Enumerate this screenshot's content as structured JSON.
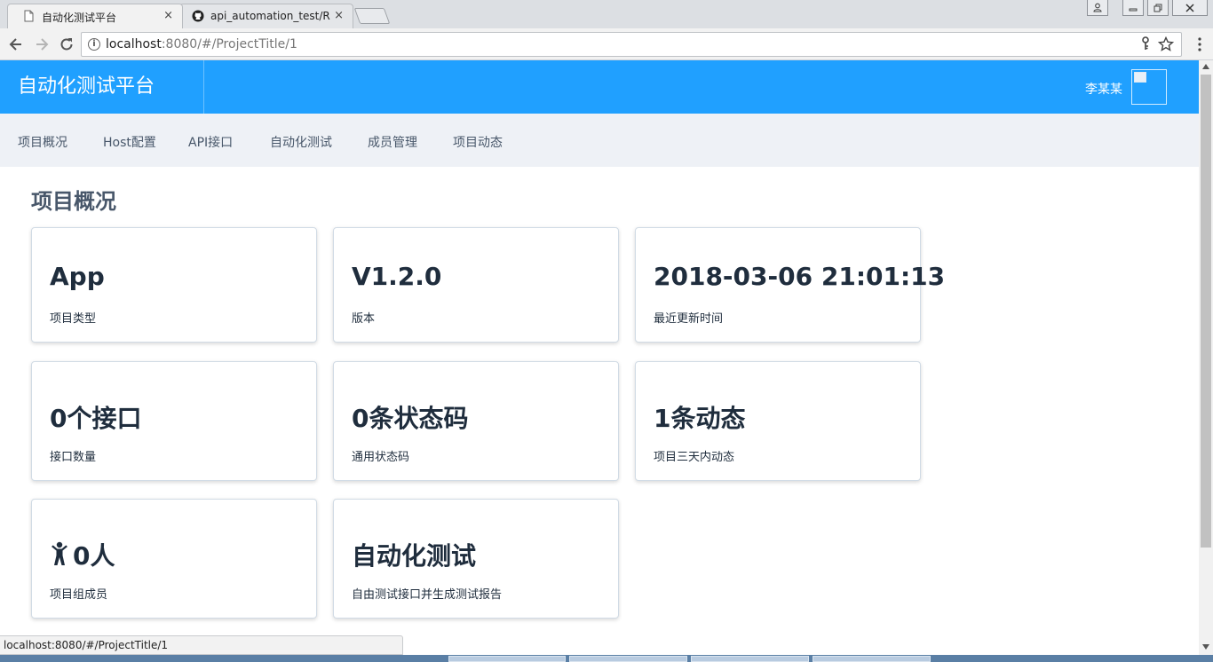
{
  "browser": {
    "tabs": [
      {
        "title": "自动化测试平台",
        "close": "×"
      },
      {
        "title": "api_automation_test/R",
        "close": "×"
      }
    ],
    "url_host": "localhost",
    "url_rest": ":8080/#/ProjectTitle/1",
    "status_text": "localhost:8080/#/ProjectTitle/1"
  },
  "header": {
    "brand": "自动化测试平台",
    "user_name": "李某某"
  },
  "nav": [
    "项目概况",
    "Host配置",
    "API接口",
    "自动化测试",
    "成员管理",
    "项目动态"
  ],
  "page_title": "项目概况",
  "cards": [
    {
      "value": "App",
      "label": "项目类型"
    },
    {
      "value": "V1.2.0",
      "label": "版本"
    },
    {
      "value": "2018-03-06 21:01:13",
      "label": "最近更新时间"
    },
    {
      "value": "0个接口",
      "label": "接口数量"
    },
    {
      "value": "0条状态码",
      "label": "通用状态码"
    },
    {
      "value": "1条动态",
      "label": "项目三天内动态"
    },
    {
      "value": "0人",
      "label": "项目组成员",
      "icon": "person-icon"
    },
    {
      "value": "自动化测试",
      "label": "自由测试接口并生成测试报告"
    }
  ],
  "colors": {
    "header_bg": "#20a0ff",
    "subnav_bg": "#eef1f6",
    "title": "#48576a"
  }
}
